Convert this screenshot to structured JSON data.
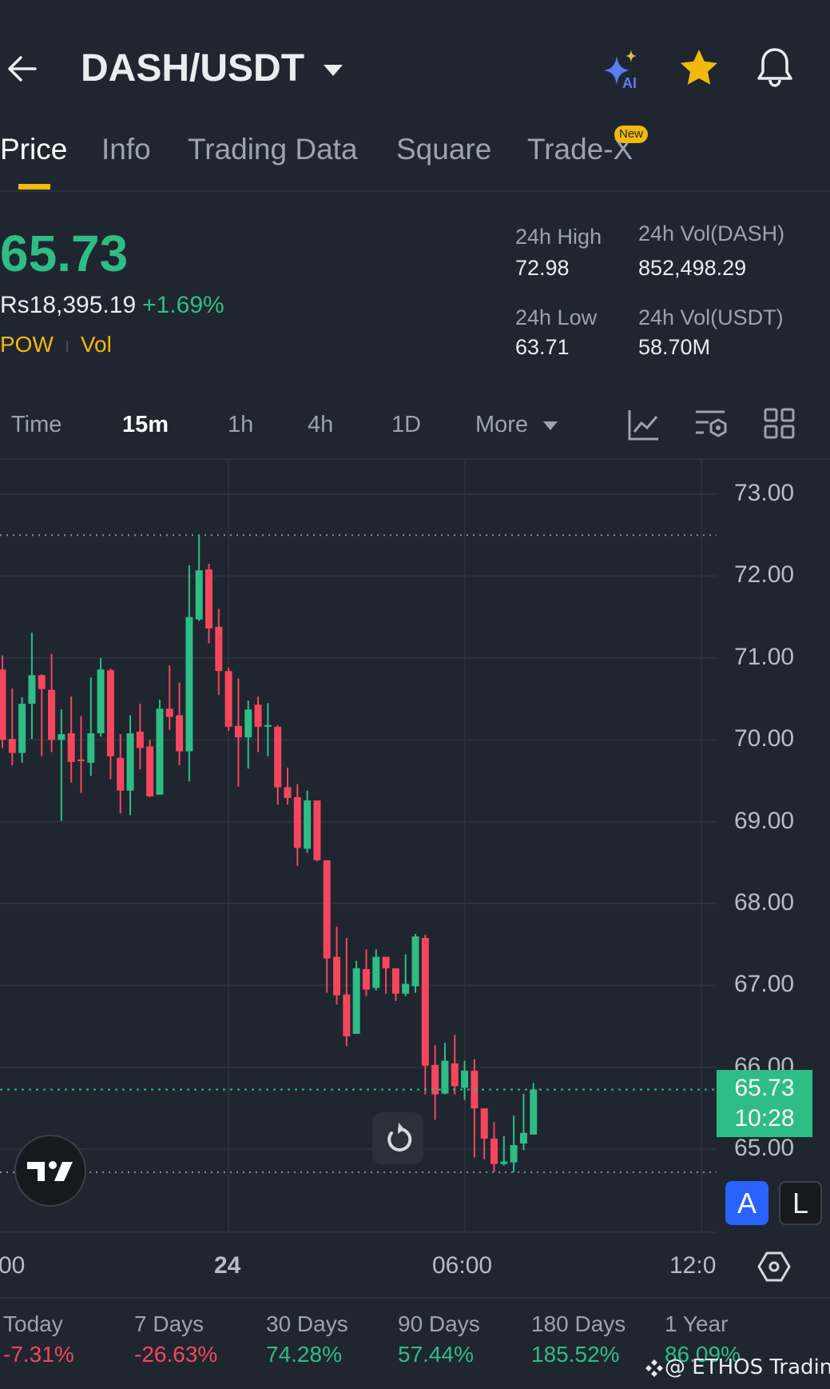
{
  "header": {
    "title": "DASH/USDT",
    "ai_label": "AI"
  },
  "tabs": [
    {
      "label": "Price"
    },
    {
      "label": "Info"
    },
    {
      "label": "Trading Data"
    },
    {
      "label": "Square"
    },
    {
      "label": "Trade-X",
      "badge": "New"
    }
  ],
  "ticker": {
    "last_price": "65.73",
    "fiat_value": "Rs18,395.19",
    "change_pct": "+1.69%",
    "tag_pow": "POW",
    "tag_vol": "Vol",
    "high_label": "24h High",
    "high_value": "72.98",
    "vol_base_label": "24h Vol(DASH)",
    "vol_base_value": "852,498.29",
    "low_label": "24h Low",
    "low_value": "63.71",
    "vol_quote_label": "24h Vol(USDT)",
    "vol_quote_value": "58.70M"
  },
  "timeframes": {
    "time": "Time",
    "m15": "15m",
    "h1": "1h",
    "h4": "4h",
    "d1": "1D",
    "more": "More"
  },
  "colors": {
    "up": "#2EBD85",
    "down": "#F6465D",
    "accent": "#F0B90B",
    "mode_active": "#2962FF"
  },
  "chart_data": {
    "type": "candlestick",
    "interval": "15m",
    "y_ticks": [
      "73.00",
      "72.00",
      "71.00",
      "70.00",
      "69.00",
      "68.00",
      "67.00",
      "66.00",
      "65.00"
    ],
    "ylim": [
      64.5,
      73.4
    ],
    "x_ticks": [
      "00",
      "24",
      "06:00",
      "12:0"
    ],
    "current_price": "65.73",
    "countdown": "10:28",
    "visible_high": 72.5,
    "visible_low": 64.72,
    "candles": [
      [
        70.86,
        71.03,
        69.9,
        70.0
      ],
      [
        70.01,
        70.63,
        69.69,
        69.84
      ],
      [
        69.84,
        70.52,
        69.72,
        70.44
      ],
      [
        70.44,
        71.31,
        70.01,
        70.79
      ],
      [
        70.79,
        70.8,
        69.8,
        70.62
      ],
      [
        70.61,
        71.05,
        69.85,
        70.0
      ],
      [
        70.0,
        70.37,
        69.01,
        70.07
      ],
      [
        70.08,
        70.53,
        69.48,
        69.73
      ],
      [
        69.76,
        70.29,
        69.35,
        69.74
      ],
      [
        69.72,
        70.76,
        69.56,
        70.08
      ],
      [
        70.08,
        71.0,
        70.04,
        70.86
      ],
      [
        70.85,
        70.87,
        69.52,
        69.8
      ],
      [
        69.78,
        70.07,
        69.1,
        69.38
      ],
      [
        69.38,
        70.3,
        69.08,
        70.08
      ],
      [
        70.1,
        70.44,
        69.64,
        69.9
      ],
      [
        69.92,
        70.0,
        69.3,
        69.31
      ],
      [
        69.33,
        70.49,
        69.33,
        70.38
      ],
      [
        70.38,
        70.91,
        70.12,
        70.28
      ],
      [
        70.3,
        70.7,
        69.69,
        69.86
      ],
      [
        69.86,
        72.13,
        69.49,
        71.5
      ],
      [
        71.47,
        72.5,
        71.45,
        72.07
      ],
      [
        72.08,
        72.15,
        71.18,
        71.36
      ],
      [
        71.38,
        71.6,
        70.55,
        70.84
      ],
      [
        70.84,
        70.88,
        70.11,
        70.16
      ],
      [
        70.17,
        70.75,
        69.43,
        70.03
      ],
      [
        70.03,
        70.48,
        69.65,
        70.37
      ],
      [
        70.43,
        70.53,
        69.85,
        70.16
      ],
      [
        70.17,
        70.45,
        69.8,
        70.18
      ],
      [
        70.16,
        70.18,
        69.21,
        69.42
      ],
      [
        69.42,
        69.66,
        69.21,
        69.29
      ],
      [
        69.3,
        69.46,
        68.46,
        68.68
      ],
      [
        68.67,
        69.38,
        68.62,
        69.26
      ],
      [
        69.26,
        69.26,
        68.52,
        68.53
      ],
      [
        68.53,
        68.53,
        66.91,
        67.33
      ],
      [
        67.35,
        67.72,
        66.77,
        66.88
      ],
      [
        66.89,
        67.58,
        66.26,
        66.38
      ],
      [
        66.41,
        67.3,
        66.41,
        67.21
      ],
      [
        67.2,
        67.44,
        66.87,
        66.95
      ],
      [
        66.97,
        67.44,
        66.94,
        67.35
      ],
      [
        67.35,
        67.35,
        66.9,
        67.21
      ],
      [
        67.21,
        67.21,
        66.81,
        66.9
      ],
      [
        66.9,
        67.38,
        66.87,
        67.02
      ],
      [
        66.99,
        67.63,
        66.91,
        67.6
      ],
      [
        67.58,
        67.62,
        65.67,
        66.02
      ],
      [
        66.03,
        66.27,
        65.36,
        65.67
      ],
      [
        65.68,
        66.3,
        65.67,
        66.08
      ],
      [
        66.05,
        66.4,
        65.67,
        65.77
      ],
      [
        65.75,
        66.08,
        65.6,
        65.96
      ],
      [
        65.96,
        66.1,
        64.9,
        65.5
      ],
      [
        65.5,
        65.5,
        64.88,
        65.13
      ],
      [
        65.13,
        65.33,
        64.72,
        64.82
      ],
      [
        64.82,
        65.16,
        64.8,
        64.85
      ],
      [
        64.84,
        65.41,
        64.72,
        65.05
      ],
      [
        65.07,
        65.68,
        64.99,
        65.2
      ],
      [
        65.18,
        65.81,
        65.18,
        65.73
      ]
    ]
  },
  "chart_controls": {
    "mode_a": "A",
    "mode_l": "L"
  },
  "performance": [
    {
      "label": "Today",
      "value": "-7.31%",
      "dir": "down"
    },
    {
      "label": "7 Days",
      "value": "-26.63%",
      "dir": "down"
    },
    {
      "label": "30 Days",
      "value": "74.28%",
      "dir": "up"
    },
    {
      "label": "90 Days",
      "value": "57.44%",
      "dir": "up"
    },
    {
      "label": "180 Days",
      "value": "185.52%",
      "dir": "up"
    },
    {
      "label": "1 Year",
      "value": "86.09%",
      "dir": "up"
    }
  ],
  "watermark": "@ ETHOS Trading"
}
